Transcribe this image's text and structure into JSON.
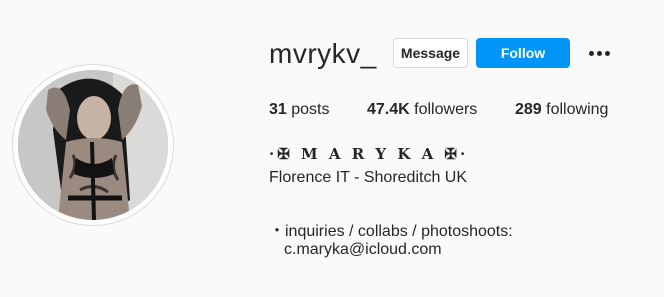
{
  "profile": {
    "username": "mvrykv_",
    "avatar_alt": "profile picture"
  },
  "actions": {
    "message_label": "Message",
    "follow_label": "Follow",
    "more_icon": "ellipsis-horizontal-icon"
  },
  "stats": {
    "posts_count": "31",
    "posts_label": "posts",
    "followers_count": "47.4K",
    "followers_label": "followers",
    "following_count": "289",
    "following_label": "following"
  },
  "bio": {
    "display_name": "·✠ M A R Y K A ✠·",
    "line1": "Florence IT - Shoreditch UK",
    "line2": "・inquiries / collabs / photoshoots:",
    "line3": "c.maryka@icloud.com"
  },
  "colors": {
    "background": "#fafafa",
    "text": "#262626",
    "follow_button": "#0095f6",
    "border": "#dbdbdb"
  }
}
